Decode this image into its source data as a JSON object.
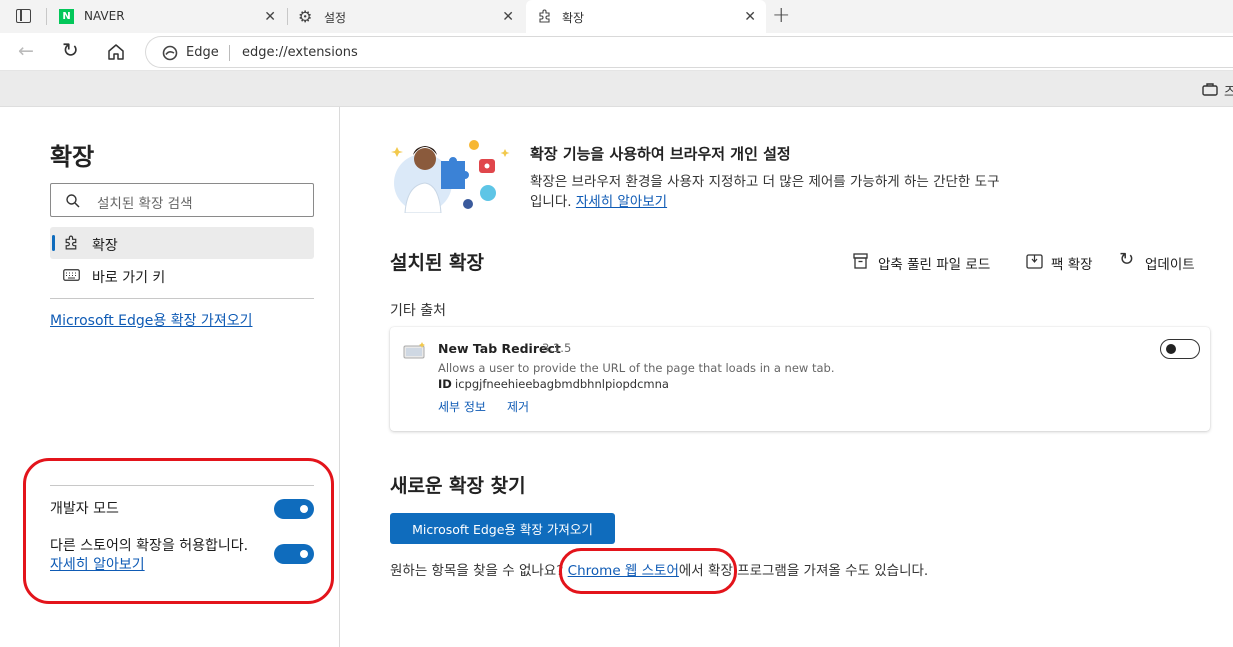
{
  "tabs": [
    {
      "title": "NAVER",
      "icon": "naver-logo"
    },
    {
      "title": "설정",
      "icon": "gear-icon"
    },
    {
      "title": "확장",
      "icon": "puzzle-icon",
      "active": true
    }
  ],
  "address": {
    "brand": "Edge",
    "url": "edge://extensions"
  },
  "favbar": {
    "overflow_text": "즈"
  },
  "sidebar": {
    "title": "확장",
    "search_placeholder": "설치된 확장 검색",
    "items": [
      {
        "label": "확장",
        "icon": "puzzle-icon",
        "selected": true
      },
      {
        "label": "바로 가기 키",
        "icon": "keyboard-icon"
      }
    ],
    "get_from_store_link": "Microsoft Edge용 확장 가져오기",
    "developer_mode": {
      "label": "개발자 모드",
      "on": true
    },
    "allow_other_stores": {
      "label": "다른 스토어의 확장을 허용합니다.",
      "link": "자세히 알아보기",
      "on": true
    }
  },
  "promo": {
    "title": "확장 기능을 사용하여 브라우저 개인 설정",
    "desc_line1": "확장은 브라우저 환경을 사용자 지정하고 더 많은 제어를 가능하게 하는 간단한 도구",
    "desc_line2": "입니다.",
    "link": "자세히 알아보기"
  },
  "installed": {
    "title": "설치된 확장",
    "actions": {
      "load_unpacked": "압축 풀린 파일 로드",
      "pack": "팩 확장",
      "update": "업데이트"
    },
    "section_label": "기타 출처",
    "extension": {
      "name": "New Tab Redirect",
      "version": "3.1.5",
      "description": "Allows a user to provide the URL of the page that loads in a new tab.",
      "id_label": "ID",
      "id": "icpgjfneehieebagbmdbhnlpiopdcmna",
      "details": "세부 정보",
      "remove": "제거",
      "enabled": false
    }
  },
  "find": {
    "title": "새로운 확장 찾기",
    "button": "Microsoft Edge용 확장 가져오기",
    "text_before": "원하는 항목을 찾을 수 없나요? ",
    "chrome_link": "Chrome 웹 스토어",
    "text_after": "에서 확장 프로그램을 가져올 수도 있습니다."
  },
  "colors": {
    "accent": "#0f6cbd",
    "highlight_ring": "#e3141b",
    "link": "#0f5bb5"
  }
}
